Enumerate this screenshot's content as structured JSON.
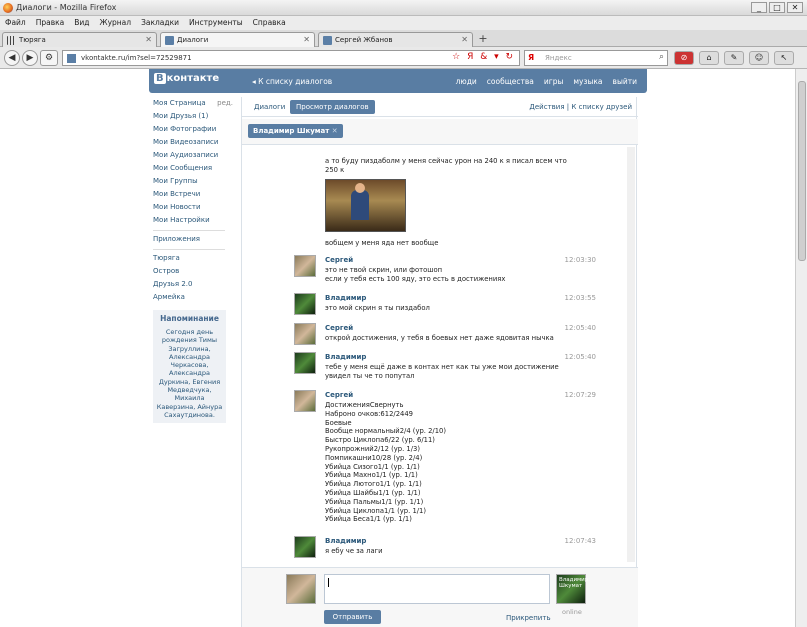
{
  "window": {
    "title": "Диалоги - Mozilla Firefox",
    "buttons": [
      "_",
      "□",
      "✕"
    ]
  },
  "menu": [
    "Файл",
    "Правка",
    "Вид",
    "Журнал",
    "Закладки",
    "Инструменты",
    "Справка"
  ],
  "tabs": [
    {
      "label": "Тюряга"
    },
    {
      "label": "Диалоги"
    },
    {
      "label": "Сергей Жбанов"
    }
  ],
  "nav": {
    "url": "vkontakte.ru/im?sel=72529871",
    "search_placeholder": "Яндекс",
    "search_logo": "Я"
  },
  "vk": {
    "logo_letter": "В",
    "logo_text": "контакте",
    "back_link": "К списку диалогов",
    "nav": [
      "люди",
      "сообщества",
      "игры",
      "музыка",
      "выйти"
    ]
  },
  "sidebar": {
    "items": [
      {
        "label": "Моя Страница",
        "extra": "ред."
      },
      {
        "label": "Мои Друзья (1)"
      },
      {
        "label": "Мои Фотографии"
      },
      {
        "label": "Мои Видеозаписи"
      },
      {
        "label": "Мои Аудиозаписи"
      },
      {
        "label": "Мои Сообщения"
      },
      {
        "label": "Мои Группы"
      },
      {
        "label": "Мои Встречи"
      },
      {
        "label": "Мои Новости"
      },
      {
        "label": "Мои Настройки"
      }
    ],
    "apps_title": "Приложения",
    "apps": [
      "Тюряга",
      "Остров",
      "Друзья 2.0",
      "Армейка"
    ]
  },
  "reminder": {
    "title": "Напоминание",
    "body": "Сегодня день рождения Тимы Загруллина, Александра Черкасова, Александра Дуркина, Евгения Медведчука, Михаила Каверзина, Айнура Сахаутдинова."
  },
  "dialog": {
    "tab_dialogs": "Диалоги",
    "tab_view": "Просмотр диалогов",
    "actions": "Действия",
    "friends_link": "К списку друзей",
    "separator": "|",
    "peer": "Владимир Шкумат",
    "peer_close": "✕"
  },
  "messages": [
    {
      "author": "",
      "time": "",
      "text": "а то буду пиздаболм у меня сейчас урон на 240 к я писал всем что\n250 к",
      "after_photo": "вобщем у меня яда нет вообще"
    },
    {
      "author": "Сергей",
      "time": "12:03:30",
      "text": "это не твой скрин, или фотошоп\nесли у тебя есть 100 яду, это есть в достижениях"
    },
    {
      "author": "Владимир",
      "time": "12:03:55",
      "text": "это мой скрин я ты пиздабол"
    },
    {
      "author": "Сергей",
      "time": "12:05:40",
      "text": "открой достижения, у тебя в боевых нет даже ядовитая нычка"
    },
    {
      "author": "Владимир",
      "time": "12:05:40",
      "text": "тебе у меня ещё даже в контах нет как ты уже мои достижение\nувидел ты че то попутал"
    },
    {
      "author": "Сергей",
      "time": "12:07:29",
      "text": "ДостиженияСвернуть\nНаброно очков:612/2449\nБоевые\nВообще нормальный2/4 (ур. 2/10)\nБыстро Циклопа6/22 (ур. 6/11)\nРукопрожний2/12 (ур. 1/3)\nПомпикашни10/28 (ур. 2/4)\nУбийца Сизого1/1 (ур. 1/1)\nУбийца Махно1/1 (ур. 1/1)\nУбийца Лютого1/1 (ур. 1/1)\nУбийца Шайбы1/1 (ур. 1/1)\nУбийца Пальмы1/1 (ур. 1/1)\nУбийца Циклопа1/1 (ур. 1/1)\nУбийца Беса1/1 (ур. 1/1)"
    },
    {
      "author": "Владимир",
      "time": "12:07:43",
      "text": "я ебу че за лаги"
    }
  ],
  "composer": {
    "send_label": "Отправить",
    "attach_label": "Прикрепить",
    "peer_name": "Владимир Шкумат",
    "status": "online"
  }
}
